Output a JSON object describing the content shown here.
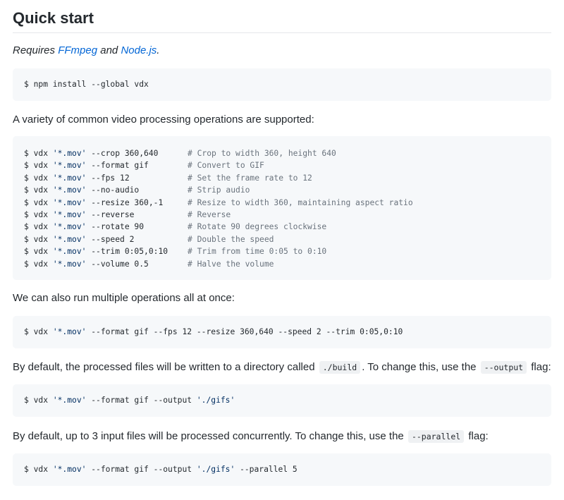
{
  "heading": "Quick start",
  "requires": {
    "prefix": "Requires ",
    "link1": "FFmpeg",
    "and": " and ",
    "link2": "Node.js",
    "suffix": "."
  },
  "install_cmd": "$ npm install --global vdx",
  "variety_text": "A variety of common video processing operations are supported:",
  "examples": [
    {
      "prefix": "$ vdx ",
      "str": "'*.mov'",
      "args": " --crop 360,640",
      "comment": "# Crop to width 360, height 640"
    },
    {
      "prefix": "$ vdx ",
      "str": "'*.mov'",
      "args": " --format gif",
      "comment": "# Convert to GIF"
    },
    {
      "prefix": "$ vdx ",
      "str": "'*.mov'",
      "args": " --fps 12",
      "comment": "# Set the frame rate to 12"
    },
    {
      "prefix": "$ vdx ",
      "str": "'*.mov'",
      "args": " --no-audio",
      "comment": "# Strip audio"
    },
    {
      "prefix": "$ vdx ",
      "str": "'*.mov'",
      "args": " --resize 360,-1",
      "comment": "# Resize to width 360, maintaining aspect ratio"
    },
    {
      "prefix": "$ vdx ",
      "str": "'*.mov'",
      "args": " --reverse",
      "comment": "# Reverse"
    },
    {
      "prefix": "$ vdx ",
      "str": "'*.mov'",
      "args": " --rotate 90",
      "comment": "# Rotate 90 degrees clockwise"
    },
    {
      "prefix": "$ vdx ",
      "str": "'*.mov'",
      "args": " --speed 2",
      "comment": "# Double the speed"
    },
    {
      "prefix": "$ vdx ",
      "str": "'*.mov'",
      "args": " --trim 0:05,0:10",
      "comment": "# Trim from time 0:05 to 0:10"
    },
    {
      "prefix": "$ vdx ",
      "str": "'*.mov'",
      "args": " --volume 0.5",
      "comment": "# Halve the volume"
    }
  ],
  "multi_text": "We can also run multiple operations all at once:",
  "multi_cmd": {
    "prefix": "$ vdx ",
    "str": "'*.mov'",
    "args": " --format gif --fps 12 --resize 360,640 --speed 2 --trim 0:05,0:10"
  },
  "default_output": {
    "before": "By default, the processed files will be written to a directory called ",
    "code1": "./build",
    "middle": ". To change this, use the ",
    "code2": "--output",
    "after": " flag:"
  },
  "output_cmd": {
    "prefix": "$ vdx ",
    "str": "'*.mov'",
    "args": " --format gif --output ",
    "str2": "'./gifs'"
  },
  "default_parallel": {
    "before": "By default, up to 3 input files will be processed concurrently. To change this, use the ",
    "code": "--parallel",
    "after": " flag:"
  },
  "parallel_cmd": {
    "prefix": "$ vdx ",
    "str": "'*.mov'",
    "args": " --format gif --output ",
    "str2": "'./gifs'",
    "args2": " --parallel 5"
  }
}
